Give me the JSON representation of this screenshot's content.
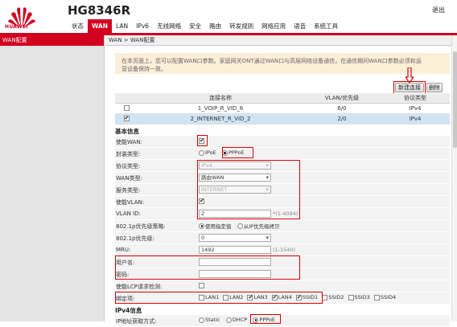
{
  "header": {
    "brand": "HUAWEI",
    "model": "HG8346R",
    "logout_label": "退出",
    "nav": [
      "状态",
      "WAN",
      "LAN",
      "IPv6",
      "无线网络",
      "安全",
      "路由",
      "转发规则",
      "网络应用",
      "语音",
      "系统工具"
    ],
    "nav_active": "WAN"
  },
  "sidebar": {
    "items": [
      "WAN配置"
    ]
  },
  "breadcrumb": "WAN > WAN配置",
  "notice": {
    "line1": "在本页面上，您可以配置WAN口参数。家庭网关ONT通过WAN口与高层网络设备通信，在通信期间WAN口参数必须和运",
    "line2": "营设备保持一致。"
  },
  "buttons": {
    "new": "新建连接",
    "delete": "删除"
  },
  "table": {
    "headers": [
      "",
      "连接名称",
      "VLAN/优先级",
      "协议类型"
    ],
    "rows": [
      {
        "checked": false,
        "name": "1_VOIP_R_VID_6",
        "vlan": "6/0",
        "proto": "IPv4",
        "selected": false
      },
      {
        "checked": true,
        "name": "2_INTERNET_R_VID_2",
        "vlan": "2/0",
        "proto": "IPv4",
        "selected": true
      }
    ]
  },
  "basic": {
    "title": "基本信息",
    "enable_wan": "使能WAN:",
    "encap": "封装类型:",
    "encap_opts": [
      "IPoE",
      "PPPoE"
    ],
    "proto": "协议类型:",
    "proto_val": "IPv4",
    "wan_type": "WAN类型:",
    "wan_type_val": "路由WAN",
    "service": "服务类型:",
    "service_val": "INTERNET",
    "enable_vlan": "使能VLAN:",
    "vlan_id": "VLAN ID:",
    "vlan_id_val": "2",
    "vlan_hint": "*(1-4094)",
    "policy": "802.1p优先级策略:",
    "policy_opts": [
      "使用指定值",
      "从IP优先级拷贝"
    ],
    "prio": "802.1p优先级:",
    "prio_val": "0",
    "mru": "MRU:",
    "mru_val": "1492",
    "mru_hint": "(1-1540)",
    "username": "用户名:",
    "username_val": "",
    "password": "密码:",
    "password_val": "",
    "lcp": "使能LCP请求检测:",
    "bind": "绑定项:",
    "bind_opts": [
      "LAN1",
      "LAN2",
      "LAN3",
      "LAN4",
      "SSID1",
      "SSID2",
      "SSID3",
      "SSID4"
    ]
  },
  "ipv4": {
    "title": "IPv4信息",
    "mode": "IP地址获取方式:",
    "mode_opts": [
      "Static",
      "DHCP",
      "PPPoE"
    ]
  },
  "colors": {
    "brand": "#d2001e",
    "highlight": "#dd0000",
    "selected_row": "#cfe4f5",
    "notice_bg": "#fcefd8"
  }
}
